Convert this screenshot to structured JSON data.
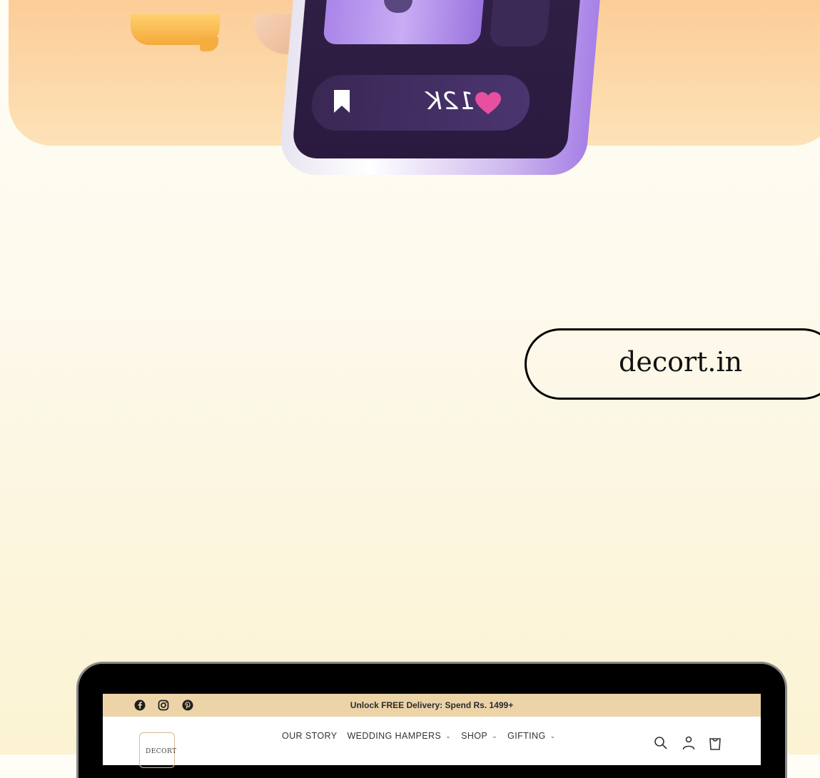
{
  "hero": {
    "likes_count": "12K"
  },
  "url_pill": {
    "text": "decort.in"
  },
  "website": {
    "announcement": "Unlock FREE Delivery: Spend Rs. 1499+",
    "logo_text": "DECORT",
    "nav": [
      {
        "label": "OUR STORY",
        "has_dropdown": false
      },
      {
        "label": "WEDDING HAMPERS",
        "has_dropdown": true
      },
      {
        "label": "SHOP",
        "has_dropdown": true
      },
      {
        "label": "GIFTING",
        "has_dropdown": true
      }
    ],
    "social_icons": [
      "facebook-icon",
      "instagram-icon",
      "pinterest-icon"
    ],
    "header_icons": [
      "search-icon",
      "account-icon",
      "cart-icon"
    ],
    "colors": {
      "announcement_bg": "#ecd3a8",
      "hero_bg": "#fcd3a0",
      "phone_accent": "#a780e6",
      "heart": "#e94fa0"
    }
  }
}
